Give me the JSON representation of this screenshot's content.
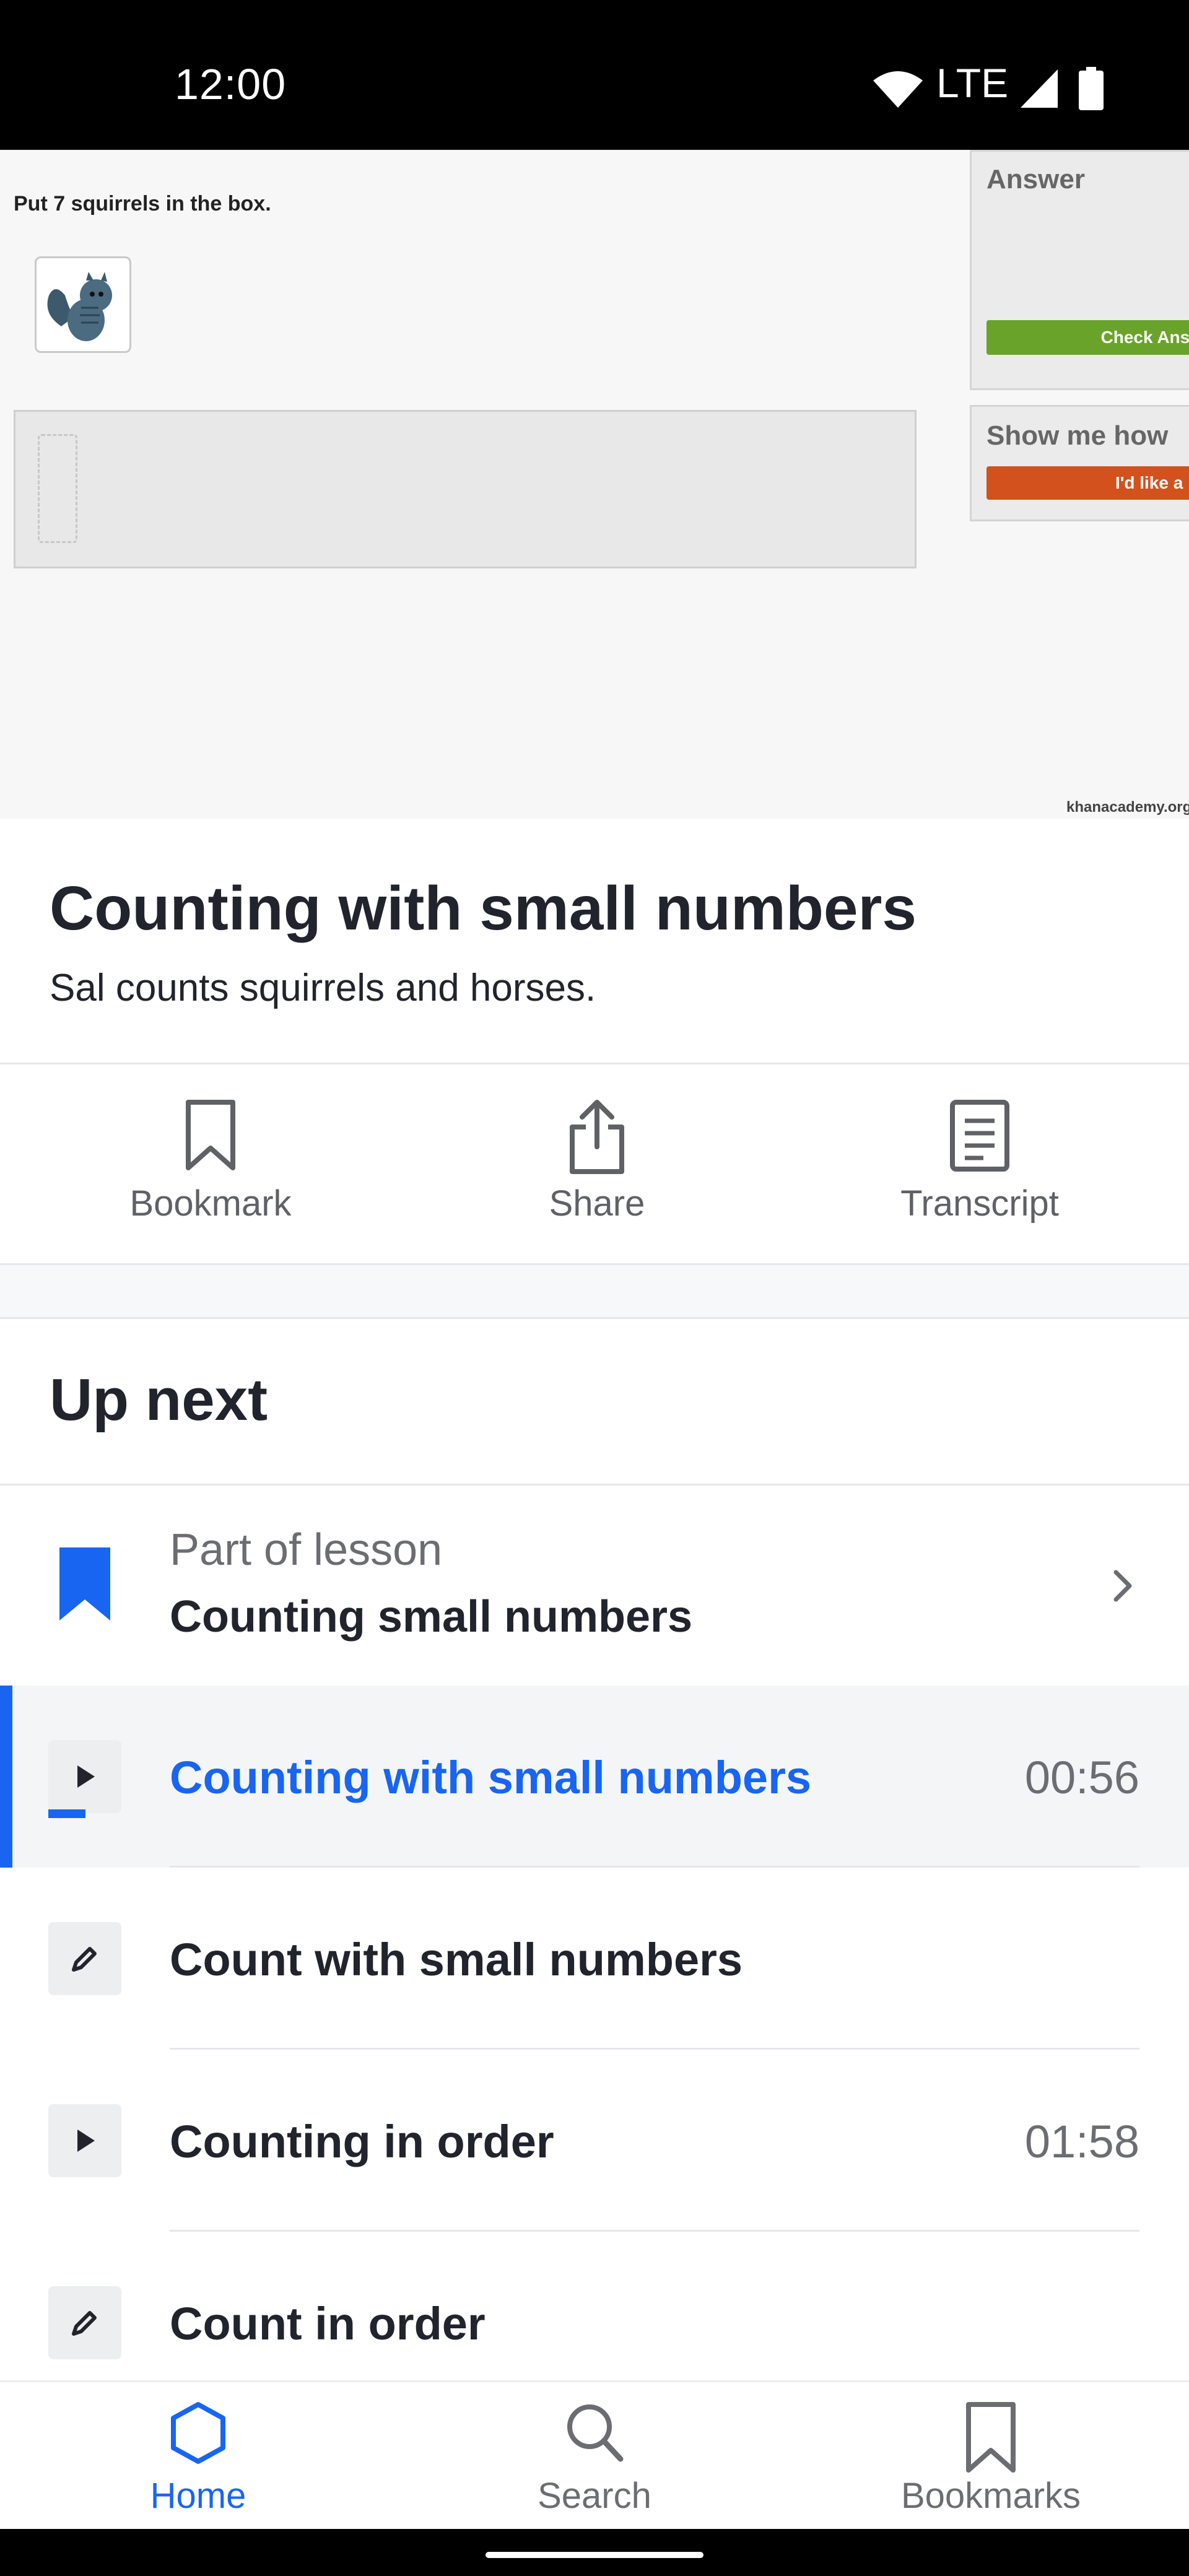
{
  "status_bar": {
    "time": "12:00",
    "network": "LTE"
  },
  "video": {
    "prompt": "Put 7 squirrels in the box.",
    "answer_label": "Answer",
    "check_button": "Check Answ",
    "show_me_label": "Show me how",
    "hint_button": "I'd like a hi",
    "watermark": "khanacademy.org"
  },
  "content": {
    "title": "Counting with small numbers",
    "description": "Sal counts squirrels and horses."
  },
  "actions": {
    "bookmark": "Bookmark",
    "share": "Share",
    "transcript": "Transcript"
  },
  "up_next": {
    "title": "Up next",
    "lesson": {
      "label": "Part of lesson",
      "name": "Counting small numbers"
    },
    "items": [
      {
        "title": "Counting with small numbers",
        "duration": "00:56",
        "type": "video",
        "active": true
      },
      {
        "title": "Count with small numbers",
        "duration": "",
        "type": "exercise"
      },
      {
        "title": "Counting in order",
        "duration": "01:58",
        "type": "video"
      },
      {
        "title": "Count in order",
        "duration": "",
        "type": "exercise"
      }
    ]
  },
  "bottom_nav": {
    "home": "Home",
    "search": "Search",
    "bookmarks": "Bookmarks"
  },
  "colors": {
    "accent": "#1865f2",
    "text": "#21242c",
    "muted": "#6b6d72",
    "check_green": "#6aa32a",
    "hint_orange": "#d3511d"
  }
}
